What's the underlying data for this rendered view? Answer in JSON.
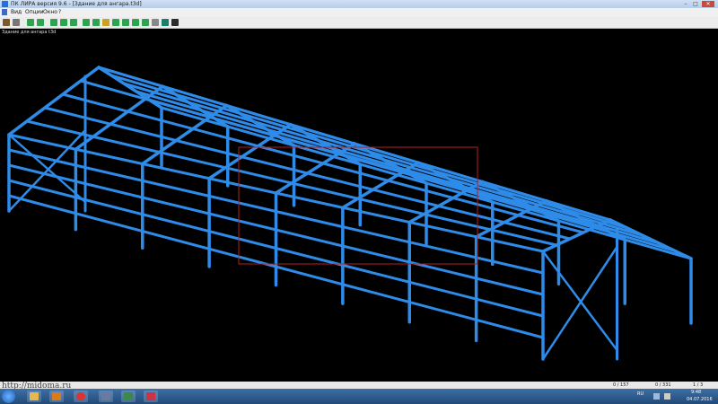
{
  "window": {
    "title": "ПК ЛИРА версия 9.6 - [Здание для ангара.t3d]",
    "controls": {
      "minimize": "–",
      "maximize": "□",
      "close": "✕"
    }
  },
  "menu": [
    "Вид",
    "Опции",
    "Окно",
    "?"
  ],
  "toolbar": {
    "icons": [
      "pencil-icon",
      "wrench-icon",
      "shield-icon",
      "shield-icon",
      "shield-icon",
      "shield-icon",
      "shield-icon",
      "shield-icon",
      "shield-icon",
      "shield-icon",
      "zoom-icon",
      "grid-icon",
      "help-icon"
    ]
  },
  "document": {
    "label": "Здание для ангара t3d"
  },
  "viewport": {
    "structure_color": "#2f8be8",
    "selection_color": "#b81e1e"
  },
  "status": {
    "count_a": "0 / 157",
    "count_b": "0 / 331",
    "page": "1 / 3"
  },
  "watermark": "http://midoma.ru",
  "taskbar": {
    "apps": [
      "windows-start",
      "explorer",
      "media",
      "chrome",
      "lira-app",
      "lira-app-2",
      "document"
    ],
    "lang": "RU",
    "time": "9:48",
    "date": "04.07.2016"
  }
}
